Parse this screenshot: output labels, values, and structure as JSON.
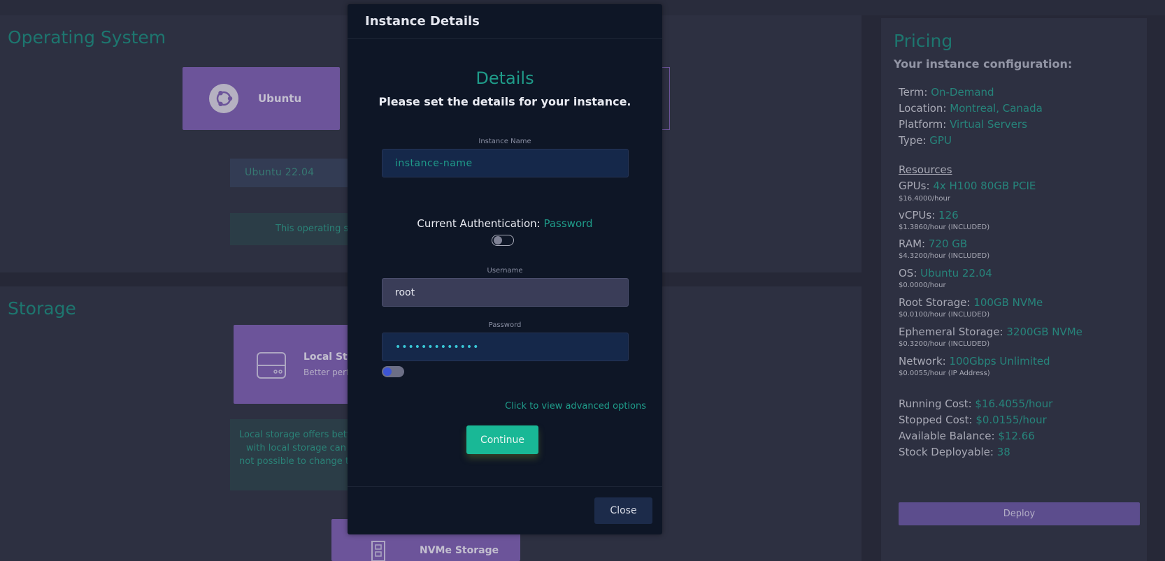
{
  "os_section": {
    "title": "Operating System",
    "card_label": "Ubuntu",
    "version": "Ubuntu 22.04",
    "note": "This operating sy"
  },
  "storage_section": {
    "title": "Storage",
    "local_title": "Local Sto",
    "local_sub": "Better perfo",
    "note_lines": [
      "Local storage offers bette",
      "with local storage can o",
      "not possible to change th"
    ],
    "nvme_label": "NVMe Storage"
  },
  "pricing": {
    "title": "Pricing",
    "subtitle": "Your instance configuration:",
    "config": [
      {
        "label": "Term:",
        "value": "On-Demand"
      },
      {
        "label": "Location:",
        "value": "Montreal, Canada"
      },
      {
        "label": "Platform:",
        "value": "Virtual Servers"
      },
      {
        "label": "Type:",
        "value": "GPU"
      }
    ],
    "resources_heading": "Resources",
    "resources": [
      {
        "label": "GPUs:",
        "value": "4x H100 80GB PCIE",
        "note": "$16.4000/hour"
      },
      {
        "label": "vCPUs:",
        "value": "126",
        "note": "$1.3860/hour (INCLUDED)"
      },
      {
        "label": "RAM:",
        "value": "720 GB",
        "note": "$4.3200/hour (INCLUDED)"
      },
      {
        "label": "OS:",
        "value": "Ubuntu 22.04",
        "note": "$0.0000/hour"
      },
      {
        "label": "Root Storage:",
        "value": "100GB NVMe",
        "note": "$0.0100/hour (INCLUDED)"
      },
      {
        "label": "Ephemeral Storage:",
        "value": "3200GB NVMe",
        "note": "$0.3200/hour (INCLUDED)"
      },
      {
        "label": "Network:",
        "value": "100Gbps Unlimited",
        "note": "$0.0055/hour (IP Address)"
      }
    ],
    "costs": [
      {
        "label": "Running Cost:",
        "value": "$16.4055/hour"
      },
      {
        "label": "Stopped Cost:",
        "value": "$0.0155/hour"
      },
      {
        "label": "Available Balance:",
        "value": "$12.66"
      },
      {
        "label": "Stock Deployable:",
        "value": "38"
      }
    ],
    "deploy_label": "Deploy"
  },
  "modal": {
    "title": "Instance Details",
    "heading": "Details",
    "description": "Please set the details for your instance.",
    "instance_name_label": "Instance Name",
    "instance_name_placeholder": "instance-name",
    "auth_label": "Current Authentication:",
    "auth_value": "Password",
    "auth_toggle_on": false,
    "username_label": "Username",
    "username_value": "root",
    "password_label": "Password",
    "password_value": "•••••••••••••",
    "show_password_toggle_on": false,
    "advanced_link": "Click to view advanced options",
    "continue_label": "Continue",
    "close_label": "Close"
  },
  "colors": {
    "accent": "#1f9c8a",
    "card": "#7f62b5",
    "modal_bg": "#0e1626",
    "continue": "#19b896"
  }
}
